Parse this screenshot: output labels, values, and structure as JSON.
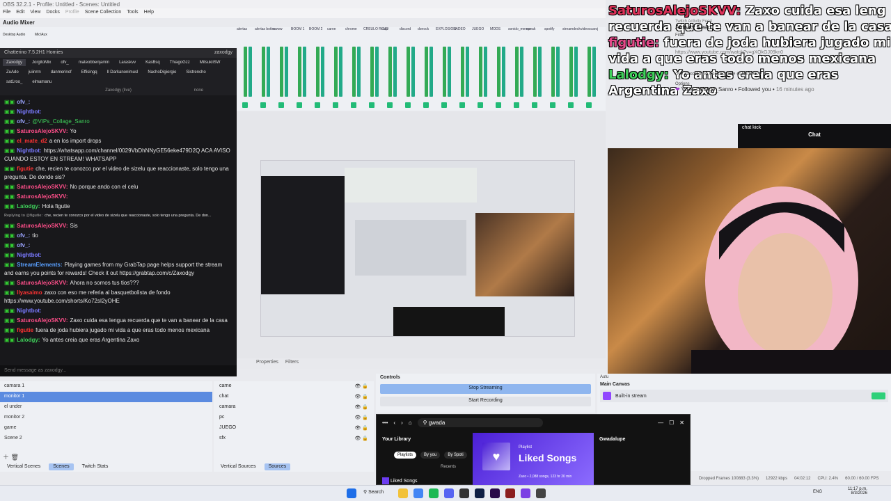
{
  "window_title": "OBS 32.2.1 - Profile: Untitled - Scenes: Untitled",
  "menu": [
    "File",
    "Edit",
    "View",
    "Docks",
    "Profile",
    "Scene Collection",
    "Tools",
    "Help"
  ],
  "audio_mixer": {
    "title": "Audio Mixer",
    "channels": [
      "Desktop Audio",
      "Mic/Aux",
      "alertas",
      "alertas bottm",
      "awww",
      "BOOM 1",
      "BOOM 2",
      "carne",
      "chrome",
      "CREULO ROJO",
      "clap",
      "discord",
      "donock",
      "EXPLOSION",
      "JADEO",
      "JUEGO",
      "MODS",
      "sonido_memor",
      "speak",
      "spotify",
      "streamdeck",
      "videoscaroj"
    ]
  },
  "chatterino": {
    "title": "Chatterino 7.5.2H1 Homies",
    "account": "zaxodgy",
    "tabs": [
      "Zaxodgy",
      "JorgitoMix",
      "ofv_",
      "mateobbenjamin",
      "Laraskvv",
      "KasBsq",
      "ThiagoGzz",
      "MitsukiiSW",
      "ZuAdo",
      "juiinrrn",
      "danmerinof",
      "Effisingq",
      "Il Darkanonimusl",
      "NachoDigiorgio",
      "Sistrencho",
      "sat1roo_",
      "elmamanu"
    ],
    "channel_label": "Zaxodgy (live)",
    "mod_label": "none",
    "input_placeholder": "Send message as zaxodgy...",
    "messages": [
      {
        "user": "ofv_:",
        "color": "#9aa4ff",
        "text": ""
      },
      {
        "user": "Nightbot:",
        "color": "#7a7aff",
        "text": ""
      },
      {
        "user": "ofv_:",
        "color": "#9aa4ff",
        "text": "@VIPs_Collage_Sanro",
        "text_color": "#3fd05a"
      },
      {
        "user": "SaturosAlejoSKVV:",
        "color": "#ff4f8a",
        "text": "Yo"
      },
      {
        "user": "el_mate_d2",
        "color": "#ff3333",
        "text": "a en los import drops"
      },
      {
        "user": "Nightbot:",
        "color": "#7a7aff",
        "text": "https://whatsapp.com/channel/0029VbDhNNyGE56eke479D2Q ACA AVISO CUANDO ESTOY EN STREAM! WHATSAPP"
      },
      {
        "user": "figutie",
        "color": "#ff3333",
        "text": "che, recien te conozco por el video de sizelu que reaccionaste, solo tengo una pregunta. De donde sis?"
      },
      {
        "user": "SaturosAlejoSKVV:",
        "color": "#ff4f8a",
        "text": "No porque ando con el celu"
      },
      {
        "user": "SaturosAlejoSKVV:",
        "color": "#ff4f8a",
        "text": ""
      },
      {
        "user": "Lalodgy:",
        "color": "#3fd05a",
        "text": "Hola figutie"
      },
      {
        "user": "Replying to @figutie:",
        "color": "#888888",
        "text": "che, recien te conozco por el video de sizelu que reaccionaste, solo tengo una pregunta. De don..."
      },
      {
        "user": "SaturosAlejoSKVV:",
        "color": "#ff4f8a",
        "text": "Sis"
      },
      {
        "user": "ofv_:",
        "color": "#9aa4ff",
        "text": "tio"
      },
      {
        "user": "ofv_:",
        "color": "#9aa4ff",
        "text": ""
      },
      {
        "user": "Nightbot:",
        "color": "#7a7aff",
        "text": ""
      },
      {
        "user": "StreamElements:",
        "color": "#5aa0ff",
        "text": "Playing games from my GrabTap page helps support the stream and earns you points for rewards! Check it out https://grabtap.com/c/Zaxodgy"
      },
      {
        "user": "SaturosAlejoSKVV:",
        "color": "#ff4f8a",
        "text": "Ahora no somos tus tios???"
      },
      {
        "user": "Ilyasaimo",
        "color": "#ff3333",
        "text": "zaxo con eso me referia al basquetbolista de fondo https://www.youtube.com/shorts/Ko72sI2yOHE"
      },
      {
        "user": "Nightbot:",
        "color": "#7a7aff",
        "text": ""
      },
      {
        "user": "SaturosAlejoSKVV:",
        "color": "#ff4f8a",
        "text": "Zaxo cuida esa lengua recuerda que te van a banear de la casa"
      },
      {
        "user": "figutie",
        "color": "#ff3333",
        "text": "fuera de joda hubiera jugado mi vida a que eras todo menos mexicana"
      },
      {
        "user": "Lalodgy:",
        "color": "#3fd05a",
        "text": "Yo antes creia que eras Argentina Zaxo"
      }
    ]
  },
  "overlay_chat": [
    {
      "user": "SaturosAlejoSKVV:",
      "text": "Zaxo cuida esa leng"
    },
    {
      "user": "",
      "text": "recuerda que te van a banear de la casa"
    },
    {
      "user": "figutie:",
      "text": "fuera de joda hubiera jugado mi"
    },
    {
      "user": "",
      "text": "vida a que eras todo menos mexicana"
    },
    {
      "user": "Lalodgy:",
      "text": "Yo antes creia que eras"
    },
    {
      "user": "",
      "text": "Argentina Zaxo"
    }
  ],
  "activity": {
    "header": "Twitch Activity Feed",
    "title": "Activity Feed",
    "filter": "Filter",
    "link": "https://www.youtube.com/watch?v=gXQkGJ09kn0",
    "question": "oye zaxo como conseguiste el fennec??",
    "options": "Options",
    "follow_user": "VIPs_Collage_Sanro",
    "follow_text": "Followed you",
    "follow_time": "16 minutes ago"
  },
  "chat_kick": {
    "header": "chat kick",
    "title": "Chat"
  },
  "properties_bar": {
    "properties": "Properties",
    "filters": "Filters"
  },
  "scenes": {
    "items": [
      "camara 1",
      "monitor 1",
      "el under",
      "monitor 2",
      "game",
      "Scene 2"
    ],
    "selected": 1,
    "tabs": [
      "Vertical Scenes",
      "Scenes",
      "Twitch Stats"
    ]
  },
  "sources": {
    "items": [
      "carne",
      "chat",
      "camara",
      "pc",
      "JUEGO",
      "sfx"
    ],
    "tabs": [
      "Vertical Sources",
      "Sources"
    ]
  },
  "controls": {
    "title": "Controls",
    "stop_streaming": "Stop Streaming",
    "start_recording": "Start Recording"
  },
  "main_canvas": {
    "title": "Main Canvas",
    "service": "Built-in stream",
    "autu": "Autu"
  },
  "spotify": {
    "search": "gwada",
    "library": "Your Library",
    "filters": [
      "Playlists",
      "By you",
      "By Spoti"
    ],
    "recents": "Recents",
    "list_item": "Liked Songs",
    "playlist_label": "Playlist",
    "playlist_title": "Liked Songs",
    "playlist_meta": "Zaxo • 2,088 songs, 123 hr 20 min",
    "artist": "Gwadalupe"
  },
  "status": {
    "dropped": "Dropped Frames 100883 (3.3%)",
    "bitrate": "12922 kbps",
    "time": "04:02:12",
    "cpu": "CPU: 2.4%",
    "fps": "60.00 / 60.00 FPS"
  },
  "taskbar": {
    "search": "Search",
    "lang": "ENG",
    "clock_time": "11:17 p.m.",
    "clock_date": "8/3/2026"
  },
  "colors": {
    "obs_bg": "#eef0f4",
    "chat_bg": "#18181b",
    "accent": "#5b8be0",
    "spotify_bg": "#121212",
    "liked_purple": "#6b3cf0"
  }
}
